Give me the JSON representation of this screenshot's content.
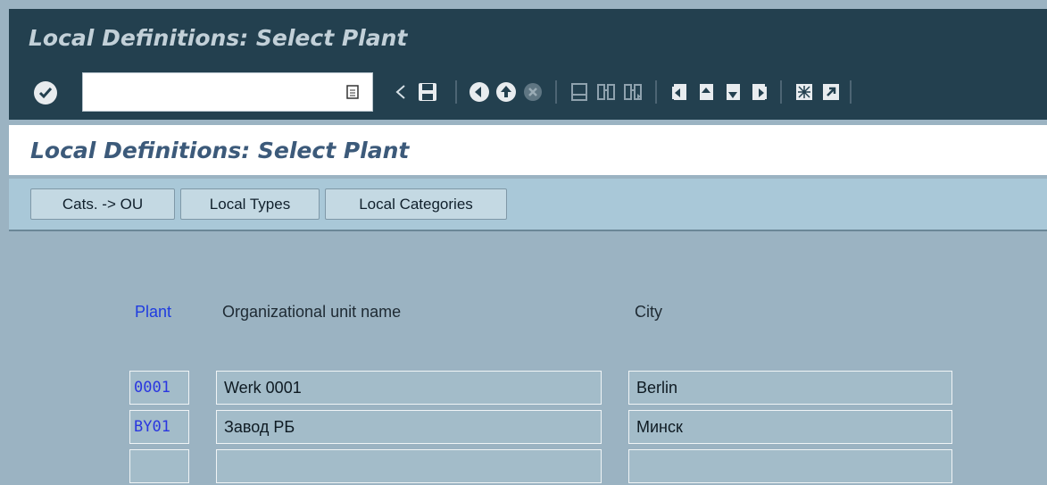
{
  "window": {
    "title": "Local Definitions: Select Plant"
  },
  "toolbar": {
    "command_field_value": "",
    "icons": [
      "enter-icon",
      "back-triangle-icon",
      "save-icon",
      "back-icon",
      "exit-icon",
      "cancel-icon",
      "print-icon",
      "find-icon",
      "find-next-icon",
      "first-page-icon",
      "previous-page-icon",
      "next-page-icon",
      "last-page-icon",
      "new-session-icon",
      "shortcut-icon"
    ]
  },
  "screen": {
    "title": "Local Definitions: Select Plant"
  },
  "app_toolbar": {
    "buttons": [
      "Cats. -> OU",
      "Local Types",
      "Local Categories"
    ]
  },
  "table": {
    "headers": {
      "plant": "Plant",
      "org_unit": "Organizational unit name",
      "city": "City"
    },
    "rows": [
      {
        "plant": "0001",
        "org_unit": "Werk 0001",
        "city": "Berlin"
      },
      {
        "plant": "BY01",
        "org_unit": "Завод РБ",
        "city": "Минск"
      },
      {
        "plant": "",
        "org_unit": "",
        "city": ""
      }
    ]
  },
  "colors": {
    "title_bar": "#23404f",
    "background": "#9bb3c2",
    "header_text": "#3c5a7a",
    "plant_blue": "#1f3ce0"
  }
}
